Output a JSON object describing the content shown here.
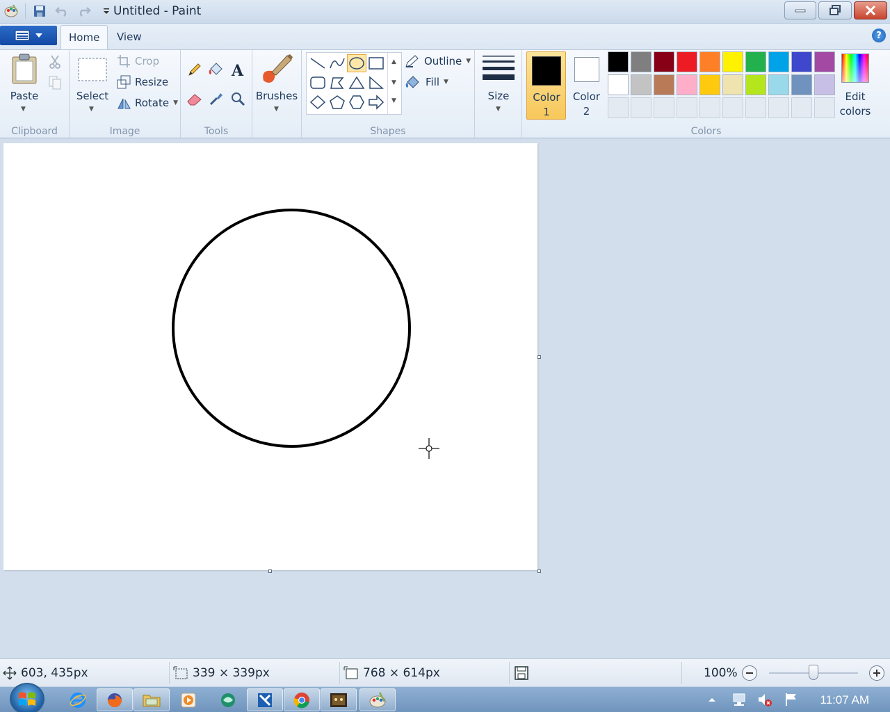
{
  "window": {
    "title": "Untitled - Paint"
  },
  "menu": {
    "tabs": [
      "Home",
      "View"
    ]
  },
  "ribbon": {
    "clipboard": {
      "label": "Clipboard",
      "paste": "Paste"
    },
    "image": {
      "label": "Image",
      "select": "Select",
      "crop": "Crop",
      "resize": "Resize",
      "rotate": "Rotate"
    },
    "tools": {
      "label": "Tools"
    },
    "brushes": {
      "label": "Brushes"
    },
    "shapes": {
      "label": "Shapes",
      "outline": "Outline",
      "fill": "Fill",
      "selected": "oval"
    },
    "size": {
      "label": "Size"
    },
    "colors": {
      "label": "Colors",
      "color1": "Color",
      "color1_num": "1",
      "color2": "Color",
      "color2_num": "2",
      "edit": "Edit",
      "edit2": "colors",
      "color1_value": "#000000",
      "color2_value": "#ffffff",
      "palette_row1": [
        "#000000",
        "#7f7f7f",
        "#880015",
        "#ed1c24",
        "#ff7f27",
        "#fff200",
        "#22b14c",
        "#00a2e8",
        "#3f48cc",
        "#a349a4"
      ],
      "palette_row2": [
        "#ffffff",
        "#c3c3c3",
        "#b97a57",
        "#ffaec9",
        "#ffc90e",
        "#efe4b0",
        "#b5e61d",
        "#99d9ea",
        "#7092be",
        "#c8bfe7"
      ]
    }
  },
  "status": {
    "cursor_pos": "603, 435px",
    "selection_size": "339 × 339px",
    "canvas_size": "768 × 614px",
    "zoom": "100%",
    "zoom_fraction": 0.5
  },
  "taskbar": {
    "clock": "11:07 AM"
  }
}
